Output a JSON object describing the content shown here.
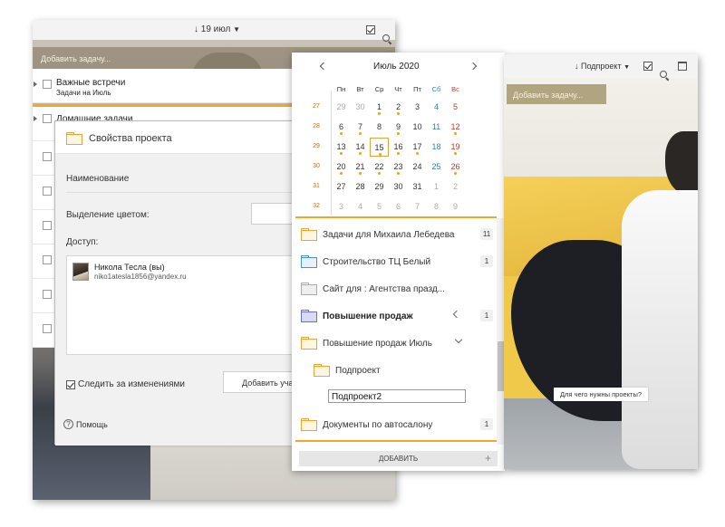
{
  "left_window": {
    "sort_label": "↓ 19 июл",
    "add_task_placeholder": "Добавить задачу...",
    "tasks": [
      {
        "title": "Важные встречи",
        "subtitle": "Задачи на Июль"
      },
      {
        "title": "Домашние задачи",
        "subtitle": ""
      }
    ]
  },
  "project_dialog": {
    "title": "Свойства проекта",
    "name_label": "Наименование",
    "color_label": "Выделение цветом:",
    "access_label": "Доступ:",
    "user_name": "Никола Тесла (вы)",
    "user_email": "niko1atesla1856@yandex.ru",
    "follow_label": "Следить за изменениями",
    "add_user_label": "Добавить участника",
    "help_label": "Помощь"
  },
  "calendar": {
    "month_label": "Июль 2020",
    "weekdays": [
      "Пн",
      "Вт",
      "Ср",
      "Чт",
      "Пт",
      "Сб",
      "Вс"
    ],
    "weeks": [
      {
        "num": "27",
        "days": [
          "29",
          "30",
          "1",
          "2",
          "3",
          "4",
          "5"
        ]
      },
      {
        "num": "28",
        "days": [
          "6",
          "7",
          "8",
          "9",
          "10",
          "11",
          "12"
        ]
      },
      {
        "num": "29",
        "days": [
          "13",
          "14",
          "15",
          "16",
          "17",
          "18",
          "19"
        ]
      },
      {
        "num": "30",
        "days": [
          "20",
          "21",
          "22",
          "23",
          "24",
          "25",
          "26"
        ]
      },
      {
        "num": "31",
        "days": [
          "27",
          "28",
          "29",
          "30",
          "31",
          "1",
          "2"
        ]
      },
      {
        "num": "32",
        "days": [
          "3",
          "4",
          "5",
          "6",
          "7",
          "8",
          "9"
        ]
      }
    ],
    "today": "15"
  },
  "projects": [
    {
      "name": "Задачи для Михаила Лебедева",
      "count": "11",
      "icon": "folder-icon"
    },
    {
      "name": "Строительство ТЦ Белый",
      "count": "1",
      "icon": "folder-shared-icon"
    },
    {
      "name": "Сайт для : Агентства празд...",
      "count": "",
      "icon": "folder-gray-icon"
    },
    {
      "name": "Повышение продаж",
      "count": "1",
      "icon": "folder-purple-icon"
    },
    {
      "name": "Повышение продаж Июль",
      "count": "",
      "icon": "folder-icon"
    },
    {
      "name": "Подпроект",
      "count": "",
      "icon": "folder-icon"
    },
    {
      "name": "Документы по автосалону",
      "count": "1",
      "icon": "folder-icon"
    }
  ],
  "subproject_input_value": "Подпроект2",
  "add_button_label": "ДОБАВИТЬ",
  "right_window": {
    "sort_label": "↓ Подпроект",
    "add_task_placeholder": "Добавить задачу...",
    "tooltip": "Для чего нужны проекты?"
  },
  "colors": {
    "accent": "#f5a623",
    "weekend": "#c0392b",
    "saturday": "#2f80c8"
  }
}
